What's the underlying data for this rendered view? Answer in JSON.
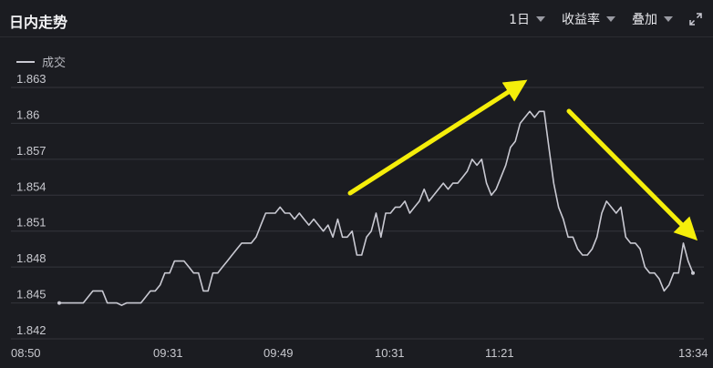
{
  "header": {
    "title": "日内走势",
    "period_label": "1日",
    "metric_label": "收益率",
    "overlay_label": "叠加"
  },
  "icons": {
    "period": "chevron-down-icon",
    "metric": "caret-down-icon",
    "overlay": "caret-down-icon",
    "expand": "expand-icon"
  },
  "colors": {
    "background": "#1b1c21",
    "line": "#c9c9d2",
    "arrow": "#f5ee0a",
    "grid": "#34353c"
  },
  "chart_data": {
    "type": "line",
    "legend": "成交",
    "y_ticks": [
      "1.863",
      "1.86",
      "1.857",
      "1.854",
      "1.851",
      "1.848",
      "1.845",
      "1.842"
    ],
    "x_ticks": [
      "08:50",
      "09:31",
      "09:49",
      "10:31",
      "11:21",
      "13:34"
    ],
    "ylim": [
      1.842,
      1.863
    ],
    "grid": true,
    "series": [
      {
        "values": [
          1.845,
          1.845,
          1.845,
          1.845,
          1.845,
          1.845,
          1.8455,
          1.846,
          1.846,
          1.846,
          1.845,
          1.845,
          1.845,
          1.8448,
          1.845,
          1.845,
          1.845,
          1.845,
          1.8455,
          1.846,
          1.846,
          1.8465,
          1.8475,
          1.8475,
          1.8485,
          1.8485,
          1.8485,
          1.848,
          1.8475,
          1.8475,
          1.846,
          1.846,
          1.8475,
          1.8475,
          1.848,
          1.8485,
          1.849,
          1.8495,
          1.85,
          1.85,
          1.85,
          1.8505,
          1.8515,
          1.8525,
          1.8525,
          1.8525,
          1.853,
          1.8525,
          1.8525,
          1.852,
          1.8525,
          1.852,
          1.8515,
          1.852,
          1.8515,
          1.851,
          1.8515,
          1.8505,
          1.852,
          1.8505,
          1.8505,
          1.851,
          1.849,
          1.849,
          1.8505,
          1.851,
          1.8525,
          1.8505,
          1.8525,
          1.8525,
          1.853,
          1.853,
          1.8535,
          1.8525,
          1.853,
          1.8535,
          1.8545,
          1.8535,
          1.854,
          1.8545,
          1.855,
          1.8545,
          1.855,
          1.855,
          1.8555,
          1.856,
          1.857,
          1.8565,
          1.857,
          1.855,
          1.854,
          1.8545,
          1.8555,
          1.8565,
          1.858,
          1.8585,
          1.86,
          1.8605,
          1.861,
          1.8605,
          1.861,
          1.861,
          1.858,
          1.855,
          1.853,
          1.852,
          1.8505,
          1.8505,
          1.8495,
          1.849,
          1.849,
          1.8495,
          1.8505,
          1.8525,
          1.8535,
          1.853,
          1.8525,
          1.853,
          1.8505,
          1.85,
          1.85,
          1.8495,
          1.848,
          1.8475,
          1.8475,
          1.847,
          1.846,
          1.8465,
          1.8475,
          1.8475,
          1.85,
          1.8485,
          1.8475
        ]
      }
    ]
  }
}
